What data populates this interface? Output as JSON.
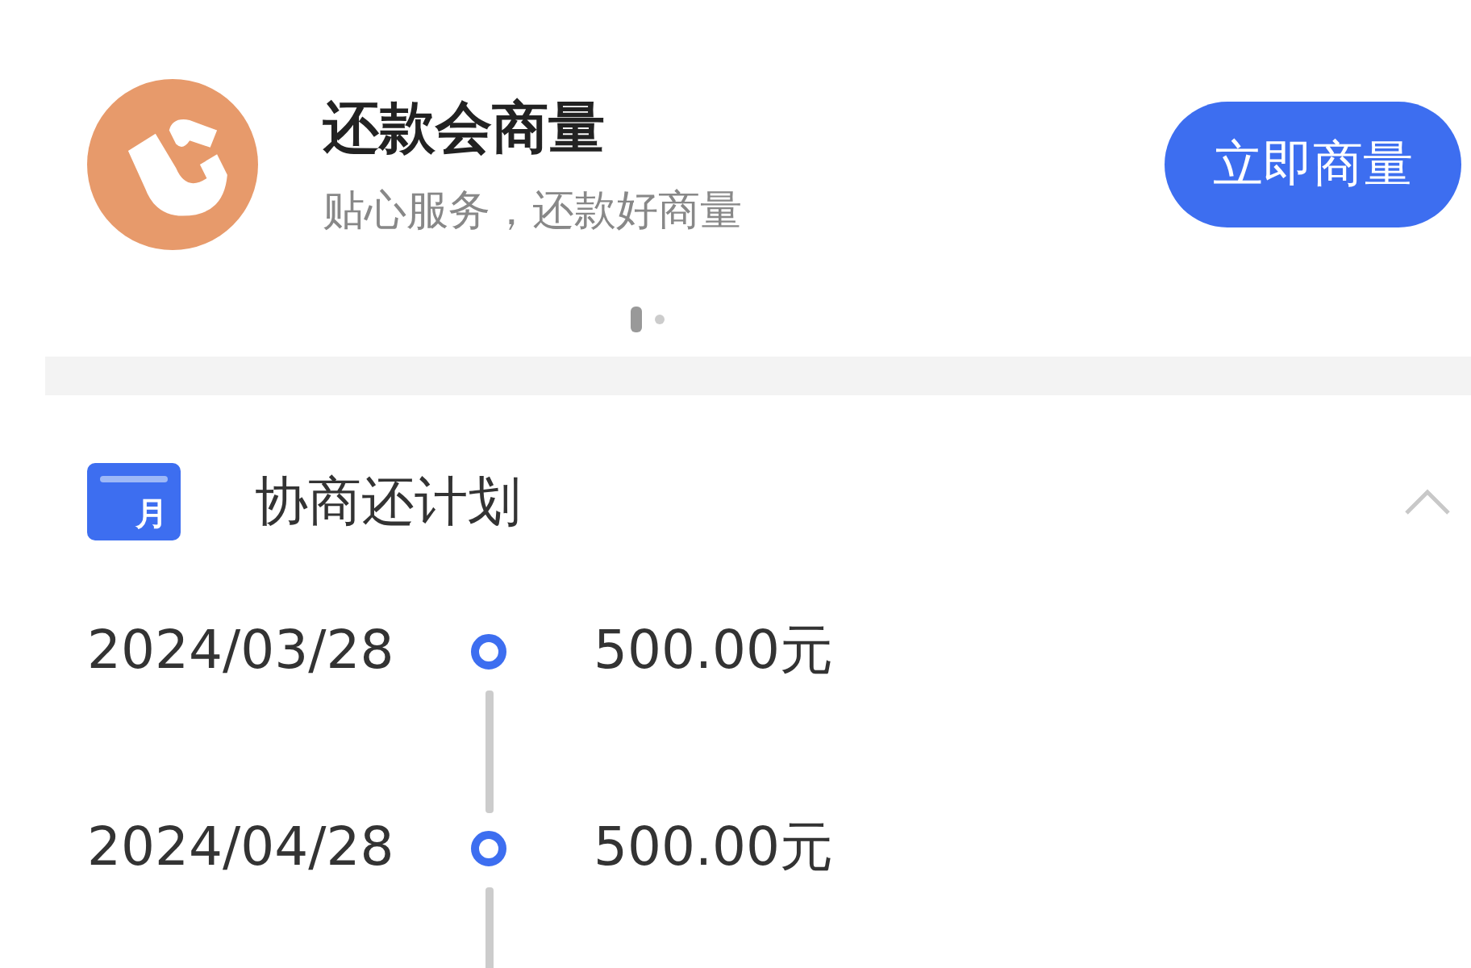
{
  "banner": {
    "title": "还款会商量",
    "subtitle": "贴心服务，还款好商量",
    "button": "立即商量"
  },
  "pager": [
    {
      "selected": true
    },
    {
      "selected": false
    }
  ],
  "plan": {
    "icon_text": "月",
    "title": "协商还计划",
    "expanded": true,
    "rows": [
      {
        "date": "2024/03/28",
        "amount": "500.00元"
      },
      {
        "date": "2024/04/28",
        "amount": "500.00元"
      }
    ]
  }
}
